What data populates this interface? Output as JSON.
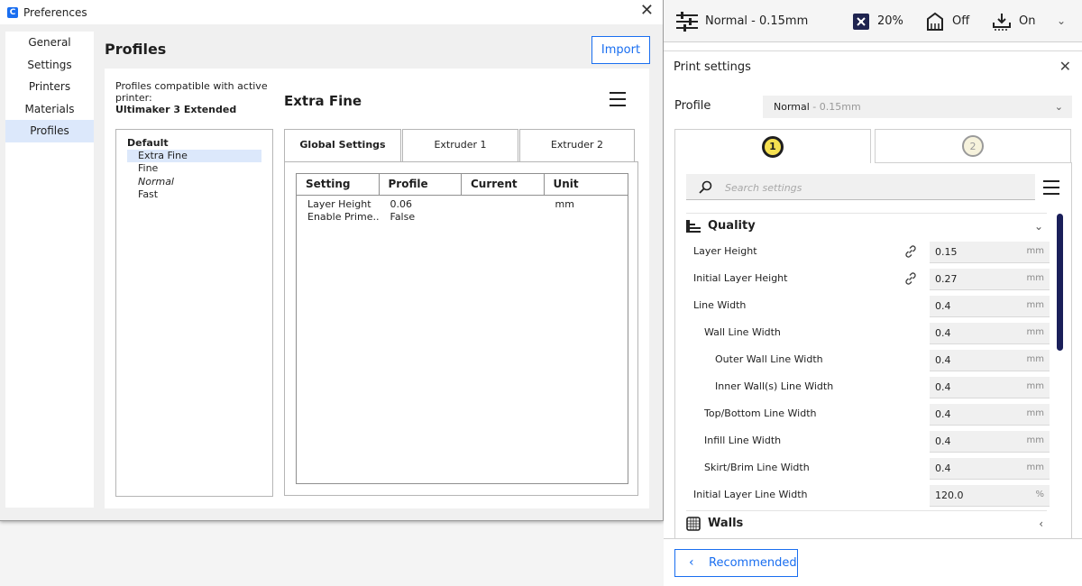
{
  "preferences": {
    "window_title": "Preferences",
    "nav": [
      "General",
      "Settings",
      "Printers",
      "Materials",
      "Profiles"
    ],
    "active_nav": "Profiles",
    "page_title": "Profiles",
    "import_label": "Import",
    "compat_text": "Profiles compatible with active printer:",
    "printer_name": "Ultimaker 3 Extended",
    "profile_group": "Default",
    "profiles": [
      "Extra Fine",
      "Fine",
      "Normal",
      "Fast"
    ],
    "selected_profile": "Extra Fine",
    "detail_name": "Extra Fine",
    "tabs": [
      "Global Settings",
      "Extruder 1",
      "Extruder 2"
    ],
    "table": {
      "headers": [
        "Setting",
        "Profile",
        "Current",
        "Unit"
      ],
      "rows": [
        [
          "Layer Height",
          "0.06",
          "",
          "mm"
        ],
        [
          "Enable Prime...",
          "False",
          "",
          ""
        ]
      ]
    }
  },
  "topbar": {
    "profile": "Normal - 0.15mm",
    "infill": "20%",
    "support": "Off",
    "adhesion": "On"
  },
  "print_settings": {
    "title": "Print settings",
    "profile_label": "Profile",
    "profile_value": "Normal",
    "profile_detail": " - 0.15mm",
    "extruder_tabs": [
      "1",
      "2"
    ],
    "search_placeholder": "Search settings",
    "categories": [
      "Quality",
      "Walls"
    ],
    "settings": [
      {
        "label": "Layer Height",
        "value": "0.15",
        "unit": "mm"
      },
      {
        "label": "Initial Layer Height",
        "value": "0.27",
        "unit": "mm"
      },
      {
        "label": "Line Width",
        "value": "0.4",
        "unit": "mm"
      },
      {
        "label": "Wall Line Width",
        "value": "0.4",
        "unit": "mm"
      },
      {
        "label": "Outer Wall Line Width",
        "value": "0.4",
        "unit": "mm"
      },
      {
        "label": "Inner Wall(s) Line Width",
        "value": "0.4",
        "unit": "mm"
      },
      {
        "label": "Top/Bottom Line Width",
        "value": "0.4",
        "unit": "mm"
      },
      {
        "label": "Infill Line Width",
        "value": "0.4",
        "unit": "mm"
      },
      {
        "label": "Skirt/Brim Line Width",
        "value": "0.4",
        "unit": "mm"
      },
      {
        "label": "Initial Layer Line Width",
        "value": "120.0",
        "unit": "%"
      }
    ],
    "recommended_label": "Recommended"
  },
  "colors": {
    "accent": "#196ef0",
    "selection": "#dce8fb",
    "scrollbar": "#1a1f5a",
    "extruder1": "#f5e050"
  }
}
